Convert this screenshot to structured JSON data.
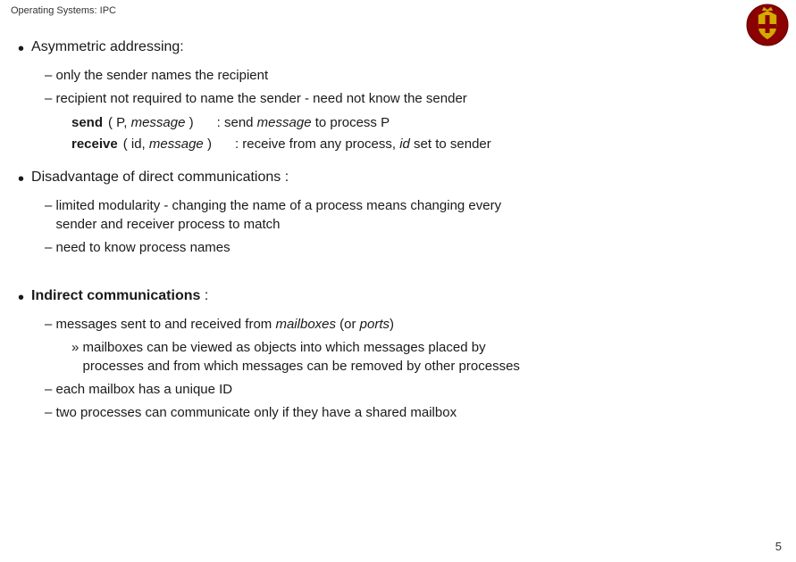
{
  "header": {
    "title": "Operating Systems: IPC"
  },
  "page_number": "5",
  "content": {
    "sections": [
      {
        "id": "asymmetric",
        "bullet": "Asymmetric addressing:",
        "subitems": [
          "– only the sender names the recipient",
          "– recipient not required to name the sender - need not know the sender"
        ],
        "code": [
          {
            "keyword": "send",
            "params": "( P, message )",
            "comment": ": send message to process P"
          },
          {
            "keyword": "receive",
            "params": "( id, message )",
            "comment": ": receive from any process, id set to sender"
          }
        ]
      },
      {
        "id": "disadvantage",
        "bullet": "Disadvantage of direct communications :",
        "subitems": [
          "– limited modularity - changing the name of a process means changing every sender and receiver process to match",
          "– need to know process names"
        ]
      },
      {
        "id": "indirect",
        "bullet": "Indirect communications :",
        "subitems": [
          "– messages sent to and received from mailboxes (or ports)",
          "» mailboxes can be viewed as objects into which messages placed by processes and from which messages can be removed by other processes",
          "– each mailbox has a unique ID",
          "– two processes can communicate only if they have a shared mailbox"
        ]
      }
    ],
    "send_italic_word": "message",
    "receive_italic_word": "message",
    "indirect_italic_mailboxes": "mailboxes",
    "indirect_italic_ports": "ports"
  }
}
